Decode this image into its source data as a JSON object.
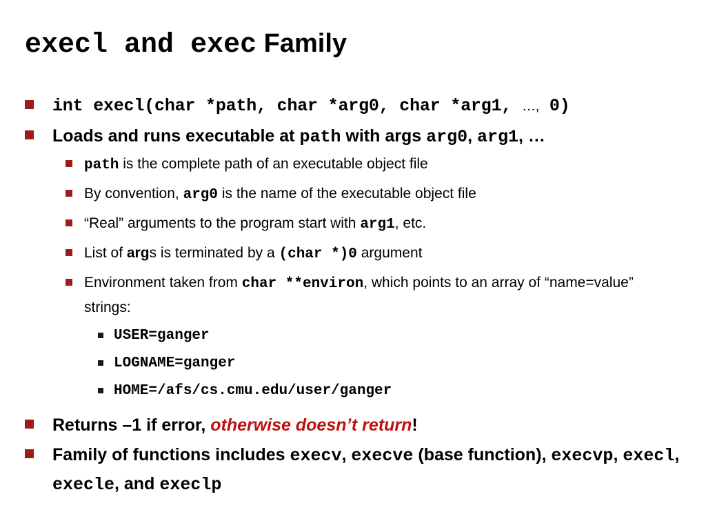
{
  "slide": {
    "title": {
      "code1": "execl",
      "conjunction": "and",
      "code2": "exec",
      "suffix": "Family"
    },
    "bullets": {
      "signature": {
        "code": "int execl(char *path, char *arg0, char *arg1,",
        "ellipsis": "…,",
        "tail": "0)"
      },
      "loads": {
        "part1": "Loads and runs executable at ",
        "code1": "path",
        "part2": " with args ",
        "code2": "arg0",
        "part3": ", ",
        "code3": "arg1",
        "part4": ", …"
      },
      "path_desc": {
        "code1": "path",
        "text": " is the complete path of an executable object file"
      },
      "convention": {
        "part1": "By convention,  ",
        "code1": "arg0",
        "part2": " is the name of the executable object file"
      },
      "real_args": {
        "part1": "“Real” arguments to the program start with ",
        "code1": "arg1",
        "part2": ", etc."
      },
      "terminator": {
        "part1": "List of ",
        "bold1": "arg",
        "part2": "s is terminated by a ",
        "code1": "(char *)0",
        "part3": " argument"
      },
      "environment": {
        "part1": "Environment taken from ",
        "code1": "char **environ",
        "part2": ", which points to an array of “name=value” strings:"
      },
      "env_vars": [
        "USER=ganger",
        "LOGNAME=ganger",
        "HOME=/afs/cs.cmu.edu/user/ganger"
      ],
      "returns": {
        "part1": "Returns –1 if error, ",
        "emphasis": "otherwise doesn’t return",
        "part2": "!"
      },
      "family": {
        "part1": "Family of functions includes  ",
        "code1": "execv",
        "part2": ",  ",
        "code2": "execve",
        "part3": " (base function),  ",
        "code3": "execvp",
        "part4": ",  ",
        "code4": "execl",
        "part5": ", ",
        "code5": "execle",
        "part6": ", and ",
        "code6": "execlp"
      }
    },
    "colors": {
      "bullet_level1": "#9c1b1b",
      "bullet_level2": "#9c1b1b",
      "bullet_level3": "#1a1a1a",
      "emphasis_red": "#bf1010",
      "text": "#000000",
      "background": "#ffffff"
    }
  }
}
